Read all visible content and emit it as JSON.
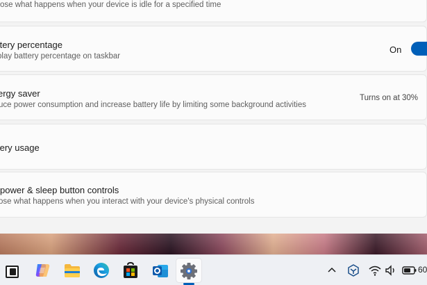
{
  "cards": {
    "idle_subtitle": "ose what happens when your device is idle for a specified time",
    "battery_percentage": {
      "title": "ttery percentage",
      "subtitle": "play battery percentage on taskbar",
      "toggle_state": "On"
    },
    "energy_saver": {
      "title": "ergy saver",
      "subtitle": "uce power consumption and increase battery life by limiting some background activities",
      "status": "Turns on at 30%"
    },
    "battery_usage": {
      "title": "tery usage"
    },
    "power_sleep": {
      "title": "power & sleep button controls",
      "subtitle": "ose what happens when you interact with your device's physical controls"
    }
  },
  "taskbar": {
    "apps": [
      "task-view",
      "copilot",
      "file-explorer",
      "edge",
      "microsoft-store",
      "outlook",
      "settings"
    ],
    "active_app": "settings",
    "tray": {
      "icons": [
        "chevron-up-icon",
        "vpn-icon",
        "wifi-icon",
        "volume-icon",
        "battery-icon"
      ],
      "battery_text": "60"
    }
  },
  "colors": {
    "accent": "#005fb8",
    "card_bg": "#fbfbfb",
    "page_bg": "#f3f3f3"
  }
}
